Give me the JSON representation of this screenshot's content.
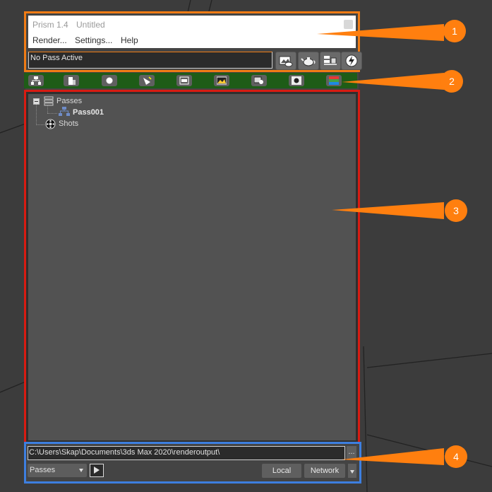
{
  "window": {
    "app_title": "Prism 1.4",
    "document_title": "Untitled"
  },
  "menu": [
    "Render...",
    "Settings...",
    "Help"
  ],
  "pass_status": "No Pass Active",
  "tree": {
    "root_label": "Passes",
    "child_label": "Pass001",
    "shots_label": "Shots"
  },
  "output": {
    "path": "C:\\Users\\Skap\\Documents\\3ds Max 2020\\renderoutput\\",
    "browse_label": "...",
    "selector_value": "Passes",
    "local_label": "Local",
    "network_label": "Network"
  },
  "callouts": [
    "1",
    "2",
    "3",
    "4"
  ],
  "colors": {
    "region1": "#f07c15",
    "region2": "#1e5c17",
    "region3": "#d81b12",
    "region4": "#3d7fe0",
    "callout": "#ff7f0f"
  }
}
